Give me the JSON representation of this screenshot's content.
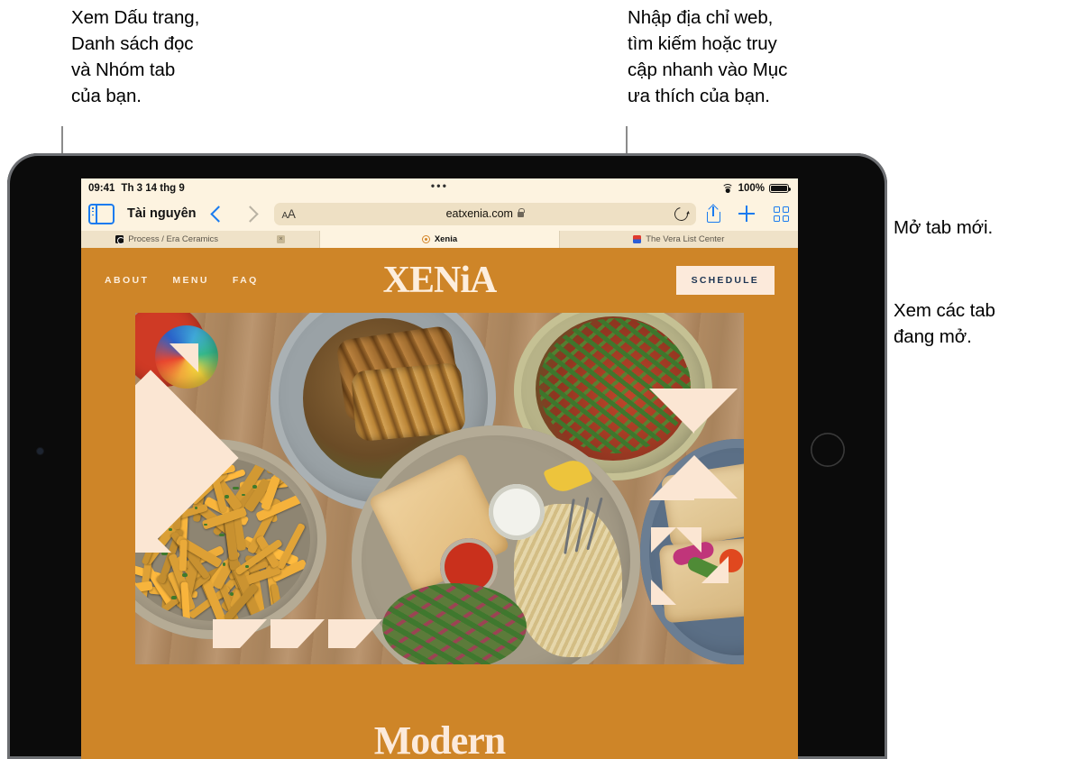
{
  "callouts": {
    "bookmarks": "Xem Dấu trang,\nDanh sách đọc\nvà Nhóm tab\ncủa bạn.",
    "address": "Nhập địa chỉ web,\ntìm kiếm hoặc truy\ncập nhanh vào Mục\nưa thích của bạn.",
    "new_tab": "Mở tab mới.",
    "show_tabs": "Xem các tab\nđang mở."
  },
  "status_bar": {
    "time": "09:41",
    "date": "Th 3 14 thg 9",
    "center_dots": "•••",
    "battery_percent": "100%",
    "wifi_icon": "wifi-icon",
    "battery_icon": "battery-icon"
  },
  "toolbar": {
    "sidebar_icon": "sidebar-icon",
    "sidebar_title": "Tài nguyên",
    "back_icon": "chevron-left-icon",
    "forward_icon": "chevron-right-icon",
    "text_size_label": "AA",
    "url": "eatxenia.com",
    "lock_icon": "lock-icon",
    "reload_icon": "reload-icon",
    "share_icon": "share-icon",
    "new_tab_icon": "plus-icon",
    "tab_overview_icon": "tab-grid-icon"
  },
  "tabs": [
    {
      "title": "Process / Era Ceramics",
      "favicon": "ceramics-favicon",
      "active": false,
      "close_label": "×"
    },
    {
      "title": "Xenia",
      "favicon": "xenia-favicon",
      "active": true,
      "close_label": ""
    },
    {
      "title": "The Vera List Center",
      "favicon": "vera-favicon",
      "active": false,
      "close_label": ""
    }
  ],
  "website": {
    "nav": [
      "ABOUT",
      "MENU",
      "FAQ"
    ],
    "logo": "XENiA",
    "schedule_button": "SCHEDULE",
    "hero_caption": "Modern",
    "accent_color": "#ce8528",
    "cream_color": "#fceadb",
    "text_color": "#1d3553"
  }
}
